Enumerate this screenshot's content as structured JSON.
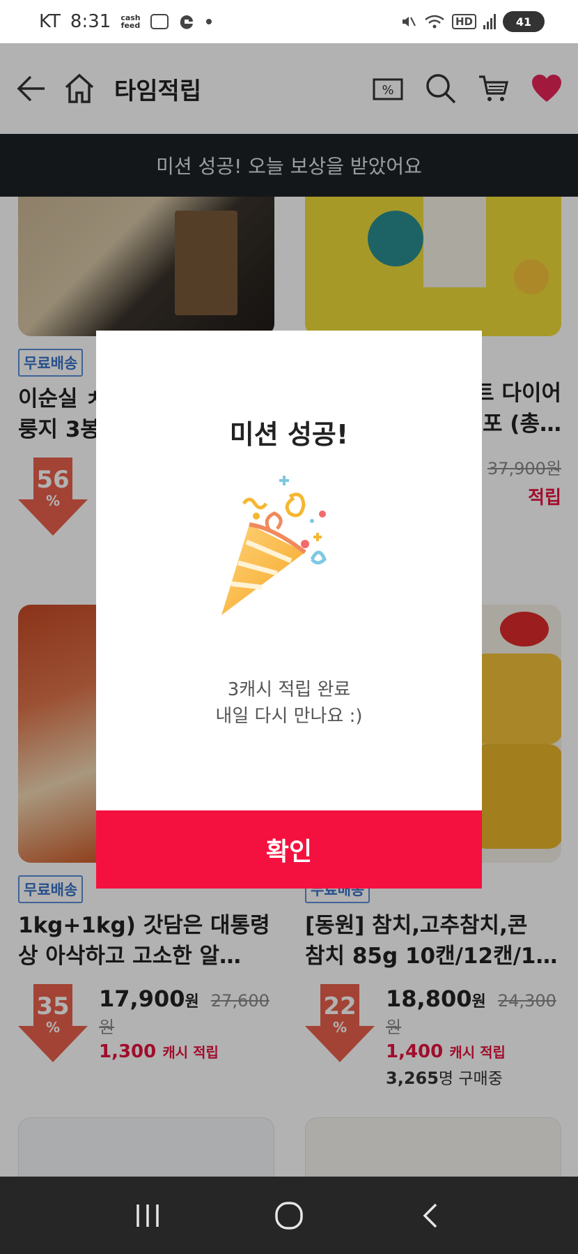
{
  "status_bar": {
    "carrier": "KT",
    "time": "8:31",
    "cashfeed_label_top": "cash",
    "cashfeed_label_bottom": "feed",
    "hd_label": "HD",
    "battery": "41"
  },
  "header": {
    "title": "타임적립"
  },
  "toast": {
    "text": "미션 성공! 오늘 보상을 받았어요"
  },
  "products": [
    {
      "badge": "무료배송",
      "name_line1": "이순실 ㅊ",
      "name_line2": "룽지 3봉",
      "discount": "56",
      "pct": "%"
    },
    {
      "name_line1": "트 다이어",
      "name_line2": "포 (총…",
      "orig_price": "37,900",
      "orig_unit": "원",
      "cash_tail": "적립"
    },
    {
      "badge": "무료배송",
      "name_line1": "1kg+1kg) 갓담은 대통령",
      "name_line2": "상 아삭하고 고소한 알…",
      "discount": "35",
      "pct": "%",
      "price": "17,900",
      "price_unit": "원",
      "orig_price": "27,600",
      "orig_unit": "원",
      "cash_amount": "1,300",
      "cash_label": "캐시 적립"
    },
    {
      "badge": "무료배송",
      "name_line1": "[동원] 참치,고추참치,콘",
      "name_line2": "참치 85g 10캔/12캔/1…",
      "discount": "22",
      "pct": "%",
      "price": "18,800",
      "price_unit": "원",
      "orig_price": "24,300",
      "orig_unit": "원",
      "cash_amount": "1,400",
      "cash_label": "캐시 적립",
      "buyers_count": "3,265",
      "buyers_label": "명 구매중"
    }
  ],
  "modal": {
    "title": "미션 성공!",
    "message_line1": "3캐시 적립 완료",
    "message_line2": "내일 다시 만나요 :)",
    "confirm_label": "확인"
  },
  "colors": {
    "accent": "#f5113f",
    "cash_red": "#e6133f",
    "toast_bg": "#1e2126",
    "badge_blue": "#3a73c8",
    "discount_arrow": "#e8604c",
    "heart": "#e8245a"
  },
  "icons": {
    "back": "back-arrow-icon",
    "home": "home-icon",
    "coupon": "coupon-icon",
    "search": "search-icon",
    "cart": "cart-icon",
    "wishlist": "heart-icon",
    "celebration": "party-popper-icon"
  }
}
